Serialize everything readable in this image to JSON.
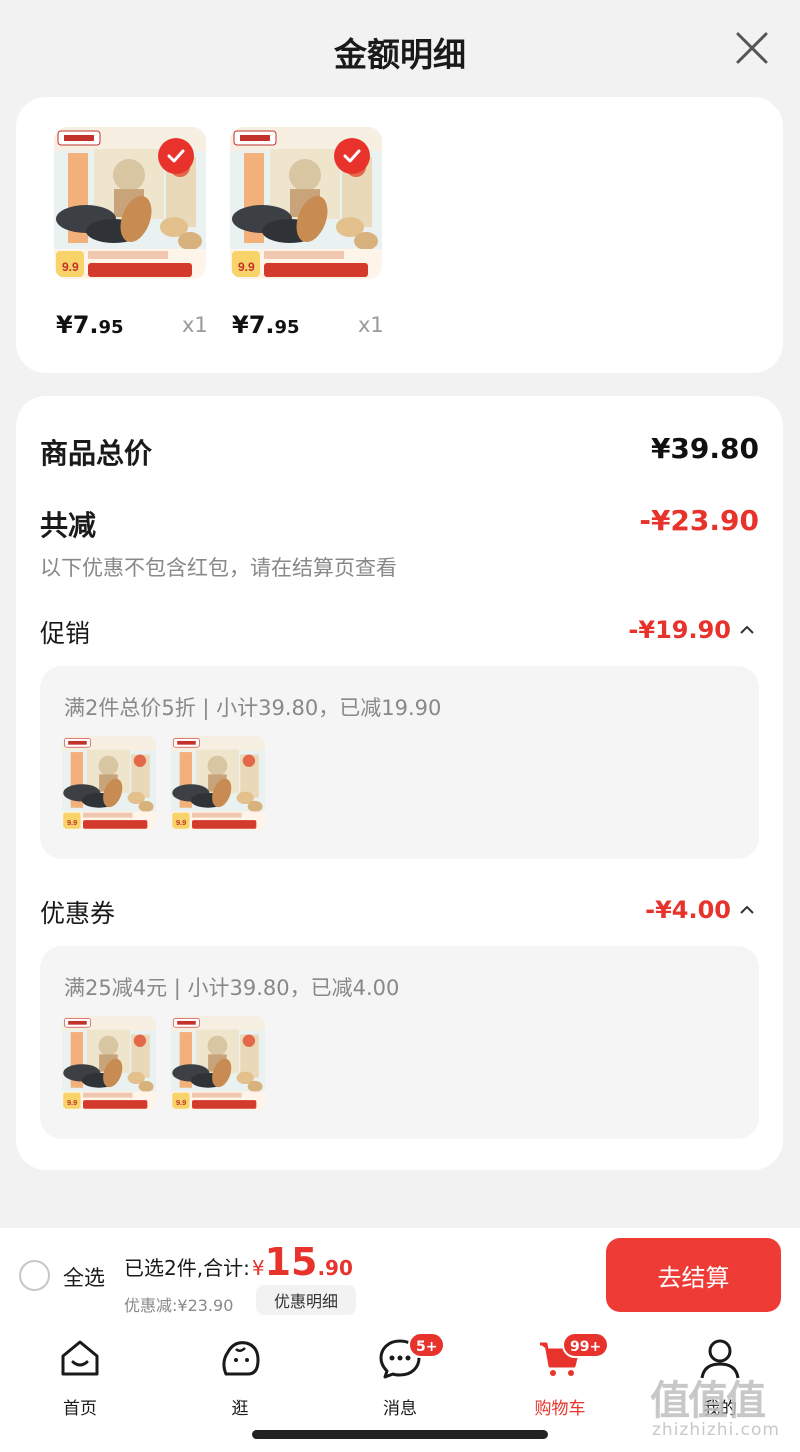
{
  "header": {
    "title": "金额明细"
  },
  "products": [
    {
      "price_main": "¥7.",
      "price_cents": "95",
      "qty": "x1"
    },
    {
      "price_main": "¥7.",
      "price_cents": "95",
      "qty": "x1"
    }
  ],
  "summary": {
    "total_label": "商品总价",
    "total_value": "¥39.80",
    "reduce_label": "共减",
    "reduce_value": "-¥23.90",
    "note": "以下优惠不包含红包，请在结算页查看"
  },
  "promotion": {
    "label": "促销",
    "value": "-¥19.90",
    "desc": "满2件总价5折 | 小计39.80，已减19.90"
  },
  "coupon": {
    "label": "优惠券",
    "value": "-¥4.00",
    "desc": "满25减4元 | 小计39.80，已减4.00"
  },
  "checkout": {
    "select_all": "全选",
    "selected_text": "已选2件,合计:",
    "currency": "¥",
    "total_big": "15",
    "total_cents": ".90",
    "discount": "优惠减:¥23.90",
    "detail_button": "优惠明细",
    "pay_button": "去结算"
  },
  "tabbar": [
    {
      "label": "首页",
      "icon": "home-icon"
    },
    {
      "label": "逛",
      "icon": "browse-icon"
    },
    {
      "label": "消息",
      "icon": "message-icon",
      "badge": "5+"
    },
    {
      "label": "购物车",
      "icon": "cart-icon",
      "badge": "99+",
      "active": true
    },
    {
      "label": "我的",
      "icon": "profile-icon"
    }
  ],
  "watermark": {
    "main": "值值值",
    "sub": "zhizhizhi.com"
  },
  "colors": {
    "accent": "#e8332d",
    "pay": "#ef3b35"
  }
}
